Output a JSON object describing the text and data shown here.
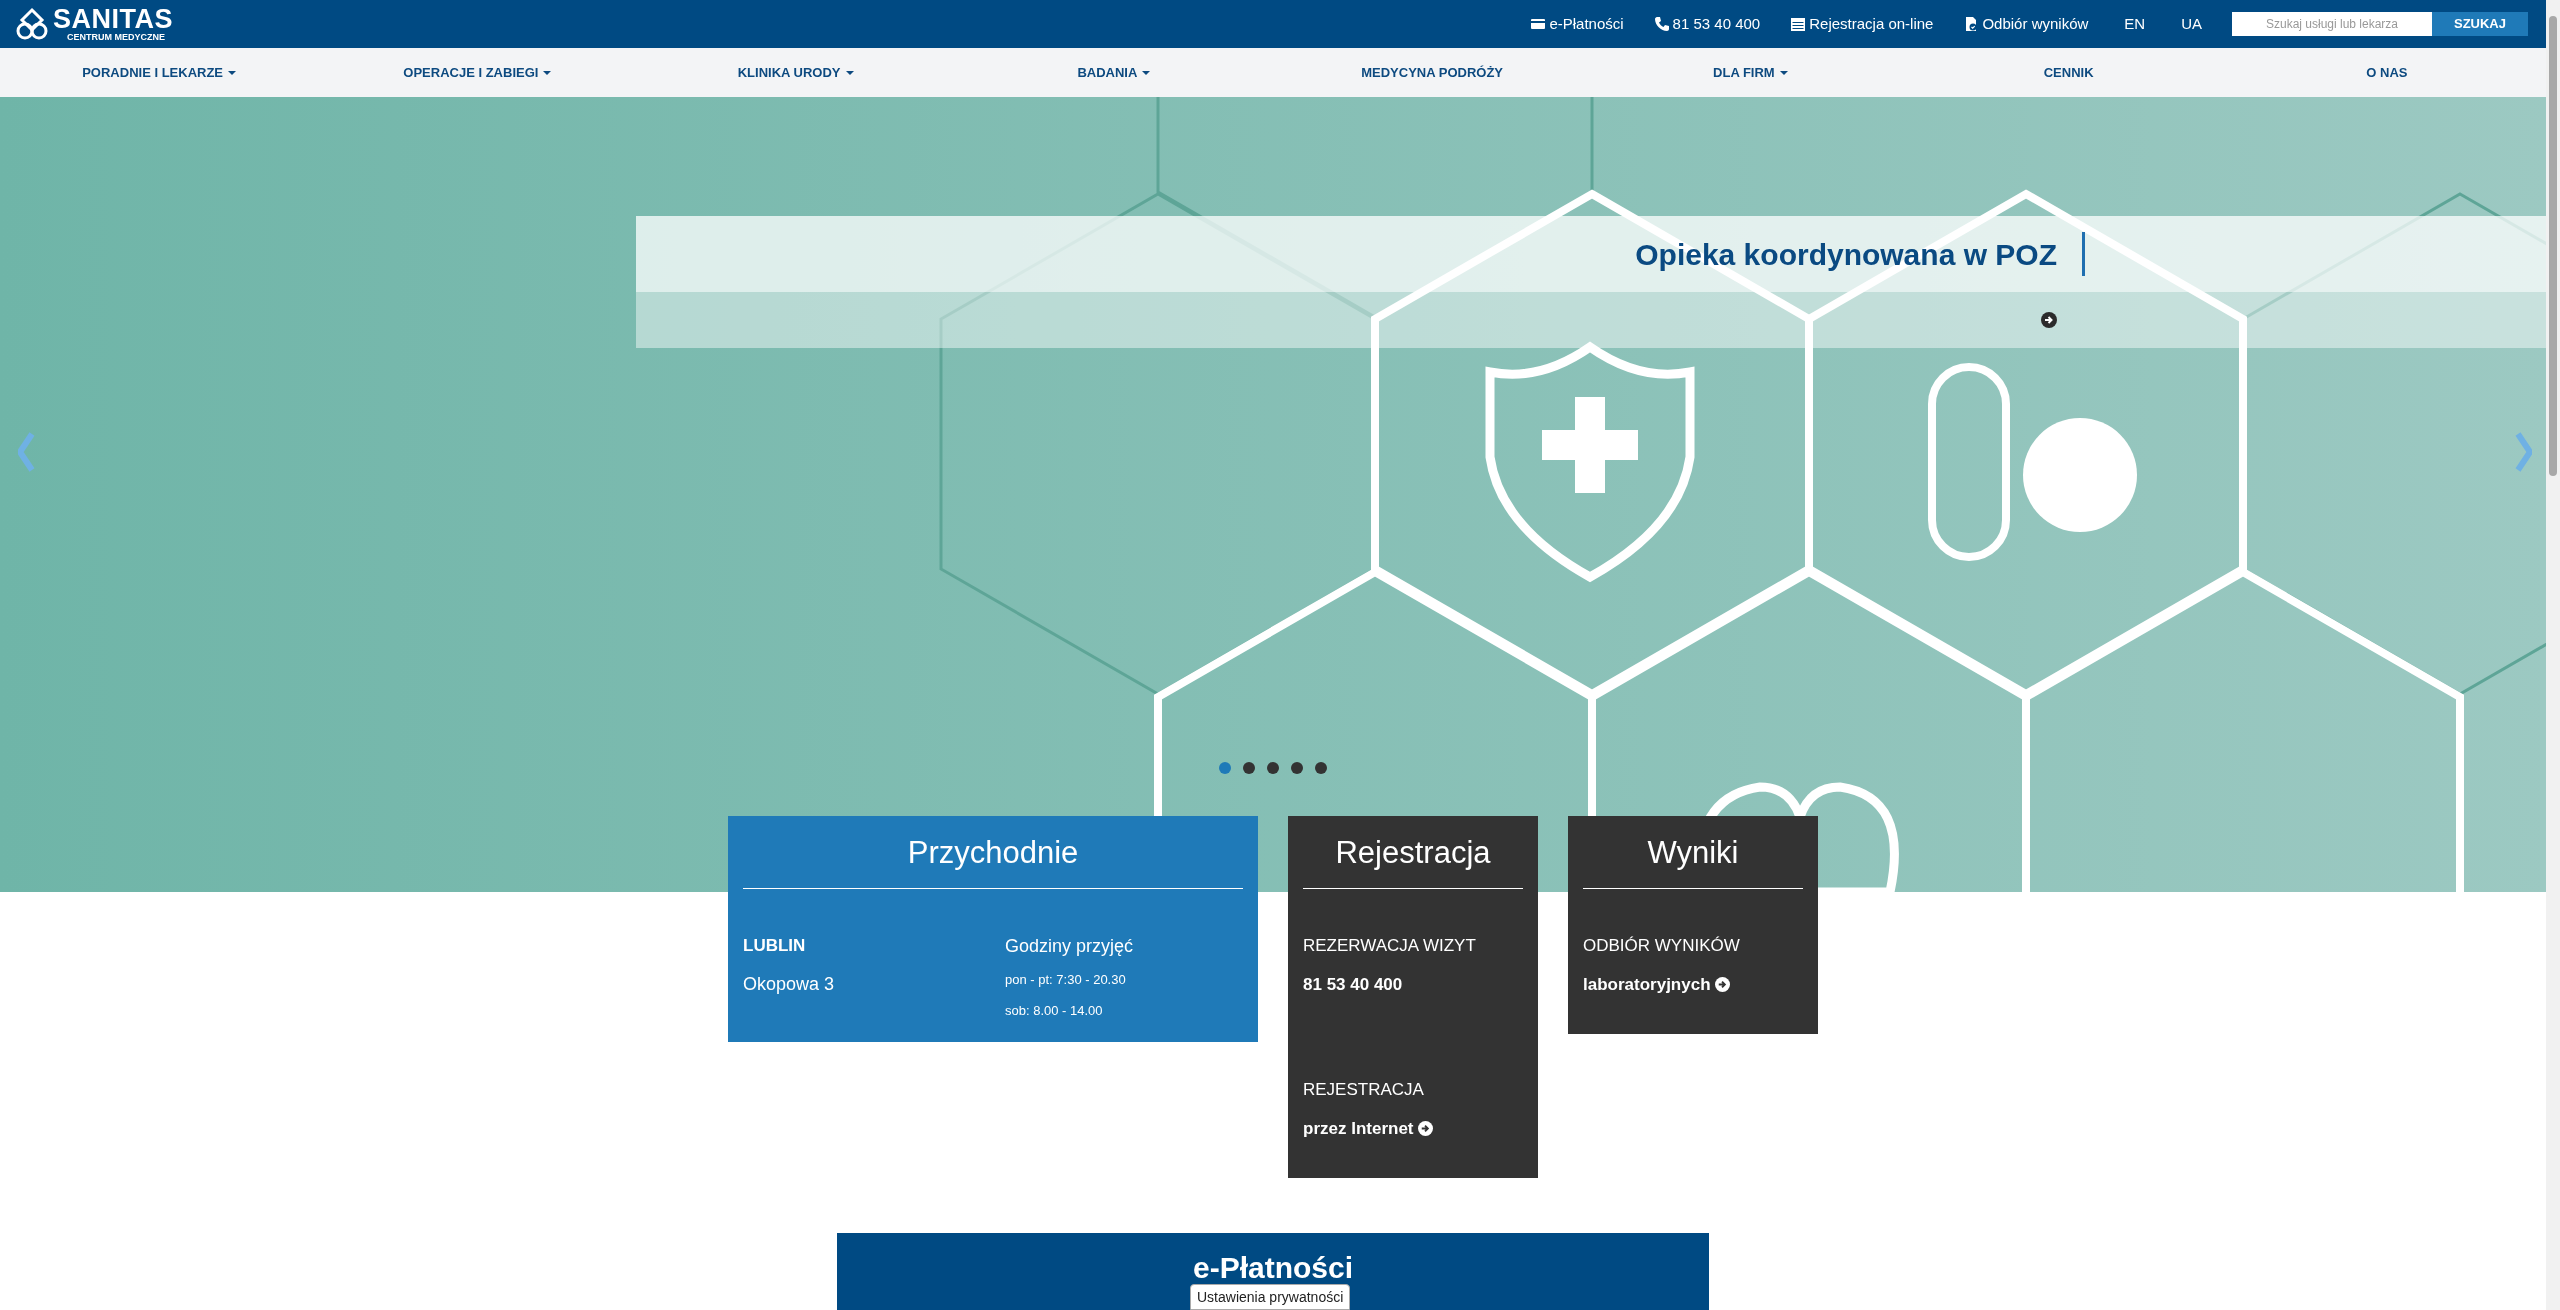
{
  "header": {
    "logo": {
      "name": "SANITAS",
      "tagline": "CENTRUM MEDYCZNE"
    },
    "links": [
      {
        "kind": "card",
        "label": "e-Płatności"
      },
      {
        "kind": "phone",
        "label": "81 53 40 400"
      },
      {
        "kind": "calendar",
        "label": "Rejestracja on-line"
      },
      {
        "kind": "document",
        "label": "Odbiór wyników"
      }
    ],
    "languages": [
      "EN",
      "UA"
    ],
    "search": {
      "placeholder": "Szukaj usługi lub lekarza",
      "button": "SZUKAJ"
    }
  },
  "nav": [
    {
      "label": "PORADNIE I LEKARZE",
      "dropdown": true
    },
    {
      "label": "OPERACJE I ZABIEGI",
      "dropdown": true
    },
    {
      "label": "KLINIKA URODY",
      "dropdown": true
    },
    {
      "label": "BADANIA",
      "dropdown": true
    },
    {
      "label": "MEDYCYNA PODRÓŻY",
      "dropdown": false
    },
    {
      "label": "DLA FIRM",
      "dropdown": true
    },
    {
      "label": "CENNIK",
      "dropdown": false
    },
    {
      "label": "O NAS",
      "dropdown": false
    }
  ],
  "slider": {
    "caption": "Opieka koordynowana w POZ",
    "slides": [
      {
        "selected": true
      },
      {
        "selected": false
      },
      {
        "selected": false
      },
      {
        "selected": false
      },
      {
        "selected": false
      }
    ]
  },
  "cards": [
    {
      "kind": "clinic",
      "title": "Przychodnie",
      "city": "LUBLIN",
      "address": "Okopowa 3",
      "hours_label": "Godziny przyjęć",
      "hours": [
        "pon - pt: 7:30 - 20.30",
        "sob: 8.00 - 14.00"
      ]
    },
    {
      "kind": "links",
      "title": "Rejestracja",
      "items": [
        {
          "label": "REZERWACJA WIZYT",
          "value": "81 53 40 400",
          "arrow": false
        },
        {
          "label": "REJESTRACJA",
          "value": "przez Internet",
          "arrow": true
        }
      ]
    },
    {
      "kind": "links",
      "title": "Wyniki",
      "items": [
        {
          "label": "ODBIÓR WYNIKÓW",
          "value": "laboratoryjnych",
          "arrow": true
        }
      ]
    }
  ],
  "payments": {
    "title": "e-Płatności"
  },
  "privacy_button": "Ustawienia prywatności"
}
